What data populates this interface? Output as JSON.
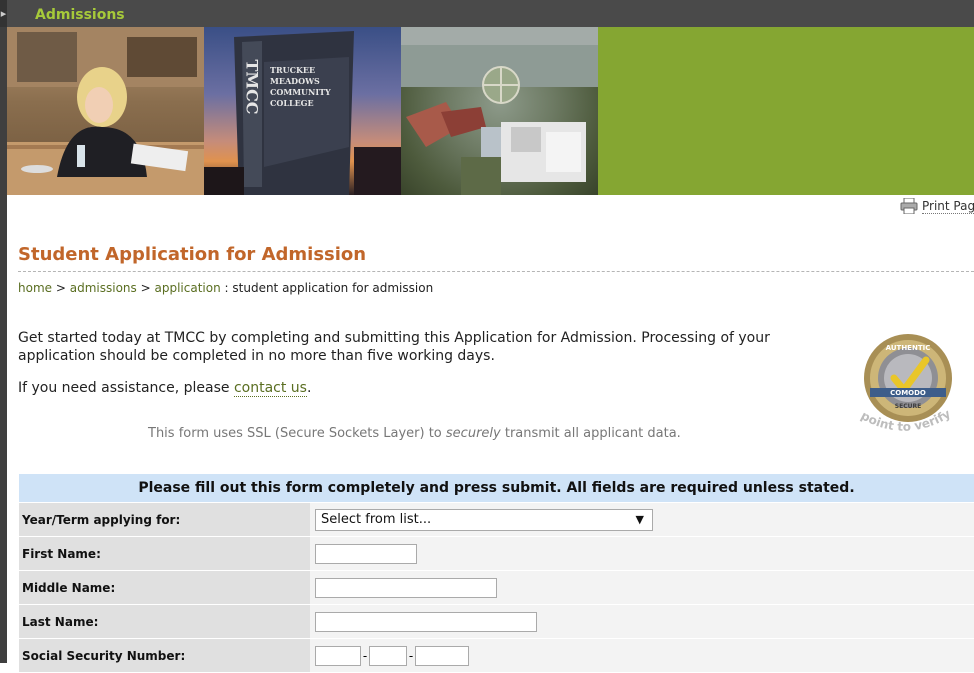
{
  "header": {
    "title": "Admissions",
    "toggle_glyph": "▸"
  },
  "banner": {
    "sign_text": "TRUCKEE MEADOWS COMMUNITY COLLEGE",
    "sign_vertical": "TMCC"
  },
  "print": {
    "label": "Print Page",
    "icon": "printer-icon"
  },
  "page_title": "Student Application for Admission",
  "breadcrumb": {
    "home": "home",
    "admissions": "admissions",
    "application": "application",
    "separator": ">",
    "current": ": student application for admission"
  },
  "intro": "Get started today at TMCC by completing and submitting this Application for Admission. Processing of your application should be completed in no more than five working days.",
  "assist": {
    "prefix": "If you need assistance, please",
    "link": "contact us",
    "suffix": "."
  },
  "ssl": {
    "before": "This form uses SSL (Secure Sockets Layer) to",
    "emphasis": "securely",
    "after": "transmit all applicant data."
  },
  "seal": {
    "top_text": "AUTHENTIC",
    "band_text": "COMODO",
    "sub_text": "SECURE",
    "caption": "point to verify"
  },
  "form": {
    "instructions": "Please fill out this form completely and press submit. All fields are required unless stated.",
    "fields": {
      "term": {
        "label": "Year/Term applying for:",
        "selected": "Select from list..."
      },
      "first": {
        "label": "First Name:",
        "value": ""
      },
      "middle": {
        "label": "Middle Name:",
        "value": ""
      },
      "last": {
        "label": "Last Name:",
        "value": ""
      },
      "ssn": {
        "label": "Social Security Number:",
        "sep": "-"
      }
    }
  },
  "colors": {
    "accent": "#c1662a",
    "link": "#5a6e21",
    "header_text": "#a6c93a",
    "form_header_bg": "#cfe3f7"
  }
}
